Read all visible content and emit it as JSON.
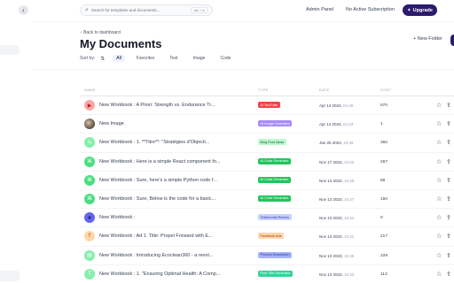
{
  "search": {
    "placeholder": "Search for templates and documents...",
    "shortcut": "ctrl + K"
  },
  "topbar": {
    "admin_panel": "Admin Panel",
    "subscription": "No Active Subscription",
    "upgrade": "Upgrade"
  },
  "header": {
    "back": "Back to dashboard",
    "title": "My Documents",
    "new_folder": "New Folder",
    "sort_by": "Sort by:",
    "filters": [
      "All",
      "Favorites",
      "Text",
      "Image",
      "Code"
    ]
  },
  "table": {
    "columns": {
      "name": "NAME",
      "type": "TYPE",
      "date": "DATE",
      "cost": "COST"
    },
    "rows": [
      {
        "name": "New Workbook : A Priori: Strength vs. Endurance Tr...",
        "type": "AI YouTube",
        "date": "Apr 14 2024,",
        "time": "04:48",
        "cost": "670",
        "icon": "youtube-icon",
        "icon_color": "#f9a8a8",
        "type_bg": "#ef4444",
        "type_fg": "#ffffff"
      },
      {
        "name": "New Image",
        "type": "AI Image Generator",
        "date": "Apr 14 2024,",
        "time": "04:43",
        "cost": "1",
        "icon": "image-thumbnail",
        "icon_color": "#6b5b4b",
        "type_bg": "#a78bfa",
        "type_fg": "#ffffff"
      },
      {
        "name": "New Workbook : 1. **Titre**: \"Stratégies d'Objecti...",
        "type": "Blog Post Ideas",
        "date": "Jan 25 2024,",
        "time": "10:08",
        "cost": "360",
        "icon": "chat-icon",
        "icon_color": "#86efac",
        "type_bg": "#bbf7d0",
        "type_fg": "#166534"
      },
      {
        "name": "New Workbook : Here is a simple React component fo...",
        "type": "AI Code Generator",
        "date": "Nov 17 2023,",
        "time": "13:00",
        "cost": "267",
        "icon": "code-icon",
        "icon_color": "#4ade80",
        "type_bg": "#22c55e",
        "type_fg": "#ffffff"
      },
      {
        "name": "New Workbook : Sure, here's a simple Python code f...",
        "type": "AI Code Generator",
        "date": "Nov 13 2023,",
        "time": "16:49",
        "cost": "86",
        "icon": "code-icon",
        "icon_color": "#4ade80",
        "type_bg": "#22c55e",
        "type_fg": "#ffffff"
      },
      {
        "name": "New Workbook : Sure, Below is the code for a basic...",
        "type": "AI Code Generator",
        "date": "Nov 13 2023,",
        "time": "16:47",
        "cost": "150",
        "icon": "code-icon",
        "icon_color": "#4ade80",
        "type_bg": "#22c55e",
        "type_fg": "#ffffff"
      },
      {
        "name": "New Workbook :",
        "type": "Testimonial Review",
        "date": "Nov 13 2023,",
        "time": "16:44",
        "cost": "0",
        "icon": "star-icon",
        "icon_color": "#6366f1",
        "type_bg": "#c7d2fe",
        "type_fg": "#3730a3"
      },
      {
        "name": "New Workbook : Ad 1: Title: Propel Forward with E...",
        "type": "Facebook Ads",
        "date": "Nov 13 2023,",
        "time": "16:42",
        "cost": "217",
        "icon": "facebook-icon",
        "icon_color": "#fed7aa",
        "type_bg": "#fed7aa",
        "type_fg": "#9a3412"
      },
      {
        "name": "New Workbook : Introducing Ecoclean360 - a revol...",
        "type": "Product Description",
        "date": "Nov 13 2023,",
        "time": "16:35",
        "cost": "229",
        "icon": "document-icon",
        "icon_color": "#86efac",
        "type_bg": "#a5b4fc",
        "type_fg": "#312e81"
      },
      {
        "name": "New Workbook : 1. \"Ensuring Optimal Health: A Comp...",
        "type": "Post Title Generator",
        "date": "Nov 13 2023,",
        "time": "16:33",
        "cost": "113",
        "icon": "title-icon",
        "icon_color": "#86efac",
        "type_bg": "#34d399",
        "type_fg": "#ffffff"
      }
    ]
  }
}
